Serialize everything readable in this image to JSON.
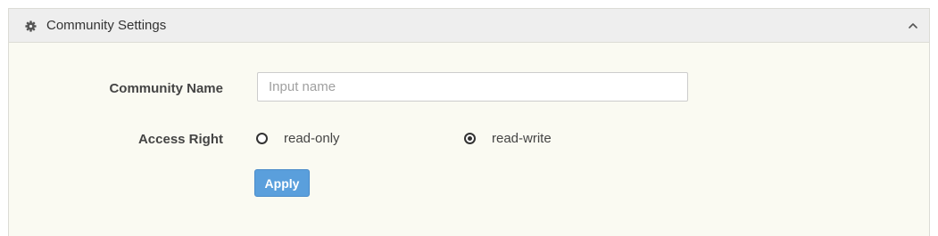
{
  "panel": {
    "title": "Community Settings",
    "header_icon": "gear-icon",
    "collapse_icon": "chevron-up-icon"
  },
  "form": {
    "community_name": {
      "label": "Community Name",
      "value": "",
      "placeholder": "Input name"
    },
    "access_right": {
      "label": "Access Right",
      "options": [
        {
          "label": "read-only",
          "selected": false
        },
        {
          "label": "read-write",
          "selected": true
        }
      ]
    },
    "apply_label": "Apply"
  },
  "colors": {
    "header_bg": "#eeeeee",
    "panel_bg": "#fafaf2",
    "apply_button": "#5a9fdc"
  }
}
